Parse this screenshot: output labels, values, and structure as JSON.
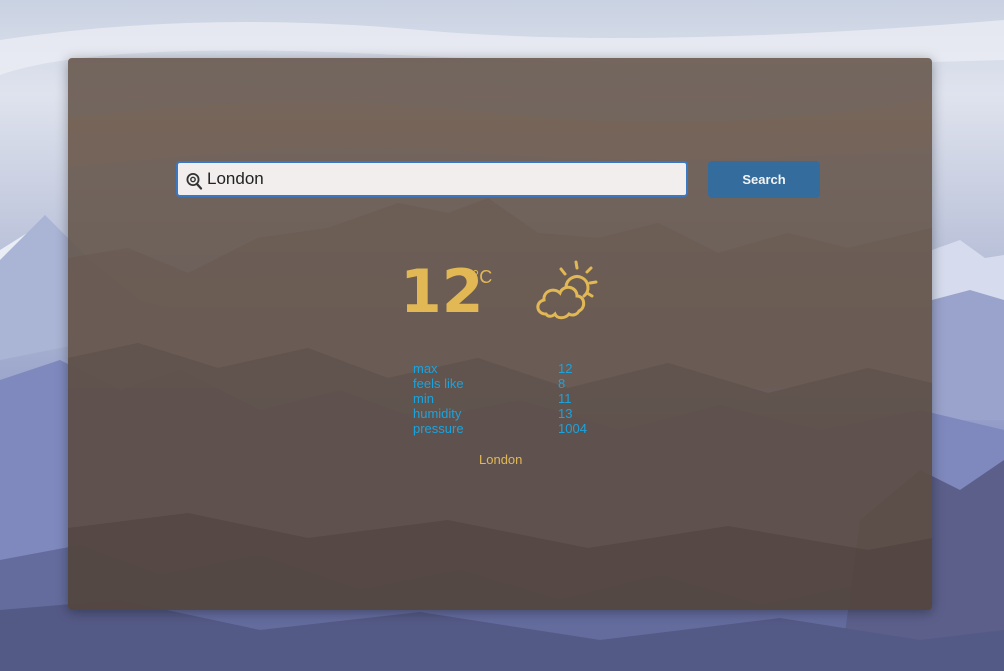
{
  "search": {
    "value": "London",
    "placeholder": "",
    "button_label": "Search",
    "icon": "search-icon"
  },
  "weather": {
    "temperature": "12",
    "unit": "°C",
    "condition_icon": "partly-sunny-icon",
    "details": [
      {
        "label": "max",
        "value": "12"
      },
      {
        "label": "feels like",
        "value": "8"
      },
      {
        "label": "min",
        "value": "11"
      },
      {
        "label": "humidity",
        "value": "13"
      },
      {
        "label": "pressure",
        "value": "1004"
      }
    ],
    "city": "London"
  },
  "colors": {
    "panel": "#625246",
    "accent_gold": "#e2b854",
    "detail_blue": "#1ba3de",
    "button": "#346d9d",
    "input_border": "#3a78c2"
  }
}
